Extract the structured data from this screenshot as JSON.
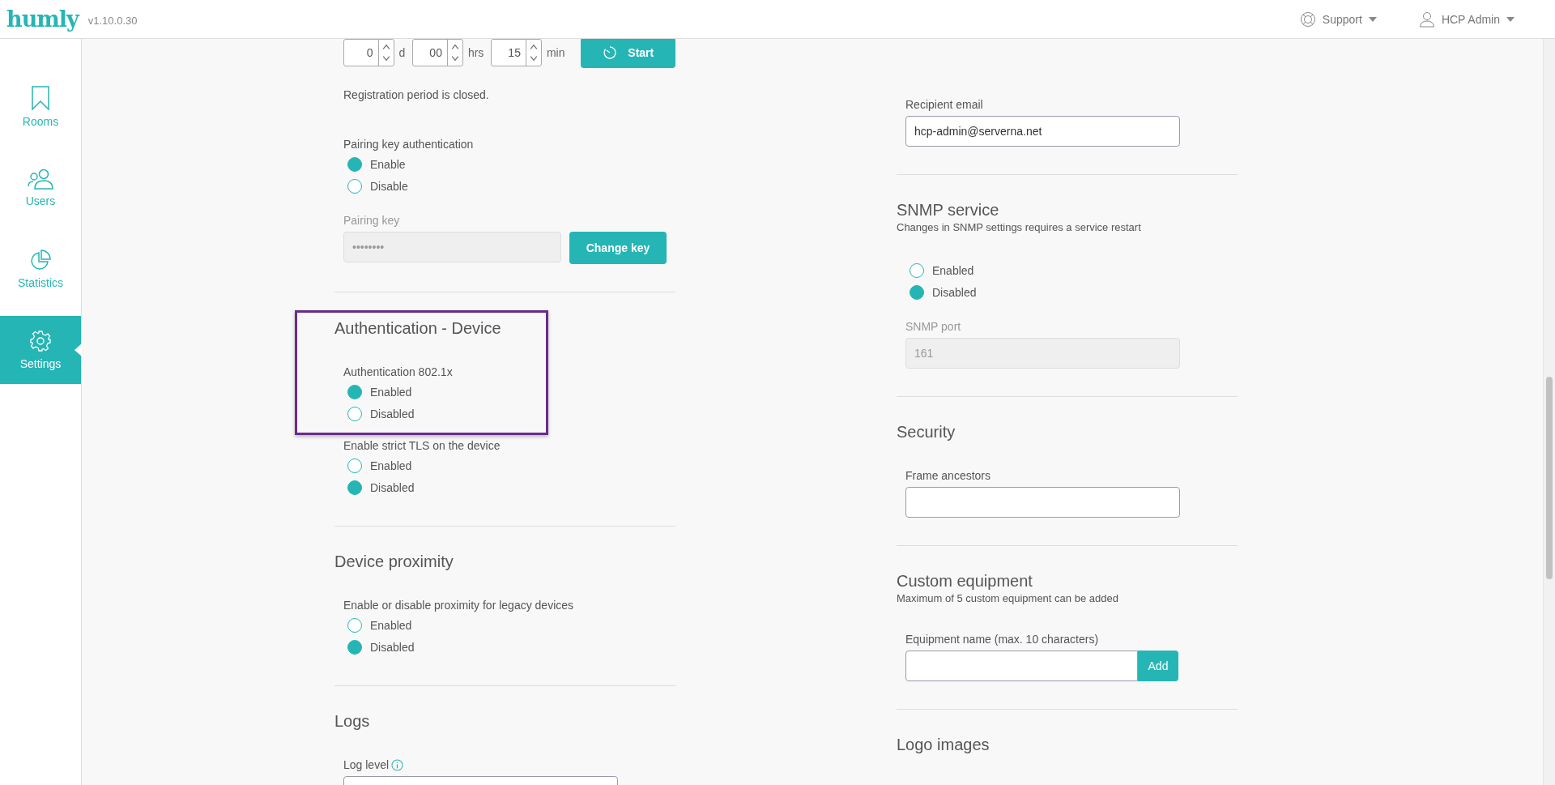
{
  "header": {
    "logo": "humly",
    "version": "v1.10.0.30",
    "menus": [
      {
        "label": "Support"
      },
      {
        "label": "HCP Admin"
      }
    ]
  },
  "sidebar": {
    "items": [
      {
        "label": "Rooms",
        "selected": false
      },
      {
        "label": "Users",
        "selected": false
      },
      {
        "label": "Statistics",
        "selected": false
      },
      {
        "label": "Settings",
        "selected": true
      }
    ]
  },
  "columns": [
    {
      "blocks": [
        {
          "kind": "timer",
          "spinners": [
            {
              "value": "0",
              "unit": "d"
            },
            {
              "value": "00",
              "unit": "hrs"
            },
            {
              "value": "15",
              "unit": "min"
            }
          ],
          "button": "Start"
        },
        {
          "kind": "text",
          "text": "Registration period is closed."
        },
        {
          "kind": "radio",
          "label": "Pairing key authentication",
          "options": [
            {
              "label": "Enable",
              "selected": true
            },
            {
              "label": "Disable",
              "selected": false
            }
          ]
        },
        {
          "kind": "field",
          "label": "Pairing key",
          "value": "••••••••",
          "disabled": true,
          "button": "Change key",
          "attached": false
        },
        {
          "kind": "divider"
        },
        {
          "kind": "highlight",
          "blocks": [
            {
              "kind": "heading",
              "title": "Authentication - Device"
            },
            {
              "kind": "radio",
              "label": "Authentication 802.1x",
              "options": [
                {
                  "label": "Enabled",
                  "selected": true
                },
                {
                  "label": "Disabled",
                  "selected": false
                }
              ]
            }
          ]
        },
        {
          "kind": "radio",
          "label": "Enable strict TLS on the device",
          "options": [
            {
              "label": "Enabled",
              "selected": false
            },
            {
              "label": "Disabled",
              "selected": true
            }
          ]
        },
        {
          "kind": "divider"
        },
        {
          "kind": "heading",
          "title": "Device proximity"
        },
        {
          "kind": "radio",
          "label": "Enable or disable proximity for legacy devices",
          "options": [
            {
              "label": "Enabled",
              "selected": false
            },
            {
              "label": "Disabled",
              "selected": true
            }
          ]
        },
        {
          "kind": "divider"
        },
        {
          "kind": "heading",
          "title": "Logs"
        },
        {
          "kind": "select",
          "label": "Log level",
          "info": true
        }
      ]
    },
    {
      "blocks": [
        {
          "kind": "field",
          "label": "Recipient email",
          "value": "hcp-admin@serverna.net",
          "disabled": false
        },
        {
          "kind": "divider"
        },
        {
          "kind": "heading",
          "title": "SNMP service",
          "subtitle": "Changes in SNMP settings requires a service restart"
        },
        {
          "kind": "radio",
          "options": [
            {
              "label": "Enabled",
              "selected": false
            },
            {
              "label": "Disabled",
              "selected": true
            }
          ]
        },
        {
          "kind": "field",
          "label": "SNMP port",
          "value": "161",
          "disabled": true
        },
        {
          "kind": "divider"
        },
        {
          "kind": "heading",
          "title": "Security"
        },
        {
          "kind": "field",
          "label": "Frame ancestors",
          "disabled": false
        },
        {
          "kind": "divider"
        },
        {
          "kind": "heading",
          "title": "Custom equipment",
          "subtitle": "Maximum of 5 custom equipment can be added"
        },
        {
          "kind": "field",
          "label": "Equipment name (max. 10 characters)",
          "disabled": false,
          "button": "Add",
          "attached": true
        },
        {
          "kind": "divider"
        },
        {
          "kind": "heading",
          "title": "Logo images"
        }
      ]
    }
  ]
}
